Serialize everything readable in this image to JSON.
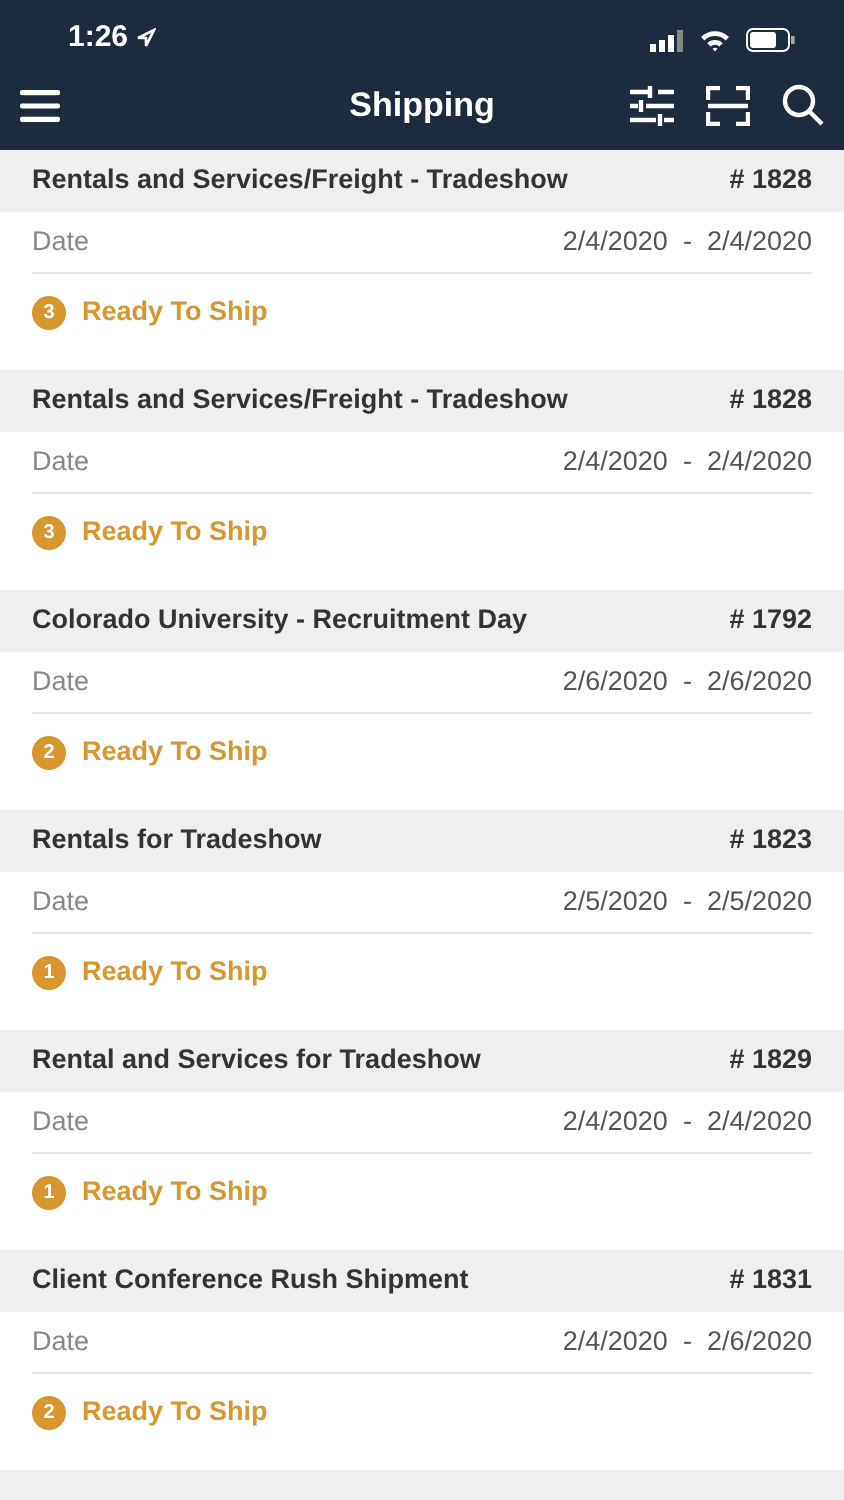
{
  "status_bar": {
    "time": "1:26"
  },
  "nav": {
    "title": "Shipping"
  },
  "shipments": [
    {
      "name": "Rentals and Services/Freight - Tradeshow",
      "number": "# 1828",
      "date_label": "Date",
      "dates": "2/4/2020  -  2/4/2020",
      "count": "3",
      "status": "Ready To Ship"
    },
    {
      "name": "Rentals and Services/Freight - Tradeshow",
      "number": "# 1828",
      "date_label": "Date",
      "dates": "2/4/2020  -  2/4/2020",
      "count": "3",
      "status": "Ready To Ship"
    },
    {
      "name": "Colorado University - Recruitment Day",
      "number": "# 1792",
      "date_label": "Date",
      "dates": "2/6/2020  -  2/6/2020",
      "count": "2",
      "status": "Ready To Ship"
    },
    {
      "name": "Rentals for Tradeshow",
      "number": "# 1823",
      "date_label": "Date",
      "dates": "2/5/2020  -  2/5/2020",
      "count": "1",
      "status": "Ready To Ship"
    },
    {
      "name": "Rental and Services for Tradeshow",
      "number": "# 1829",
      "date_label": "Date",
      "dates": "2/4/2020  -  2/4/2020",
      "count": "1",
      "status": "Ready To Ship"
    },
    {
      "name": "Client Conference Rush Shipment",
      "number": "# 1831",
      "date_label": "Date",
      "dates": "2/4/2020  -  2/6/2020",
      "count": "2",
      "status": "Ready To Ship"
    }
  ]
}
